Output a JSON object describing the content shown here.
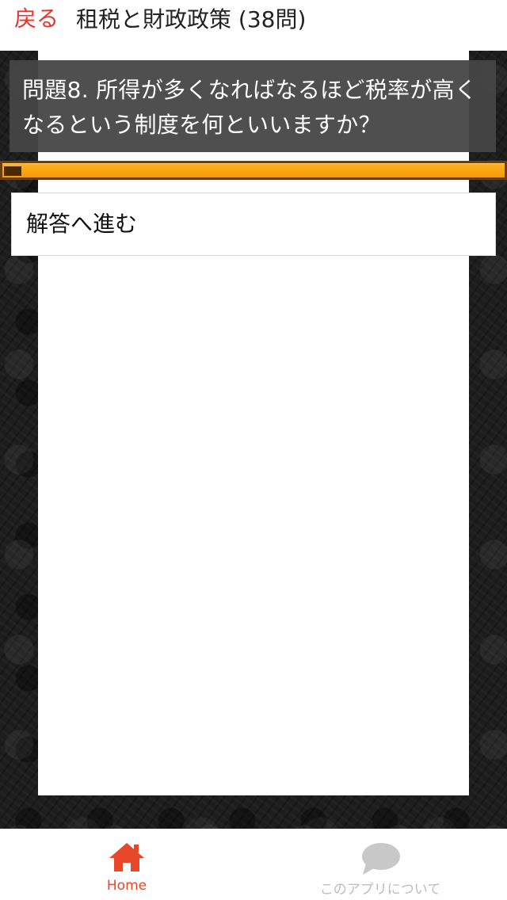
{
  "header": {
    "back_label": "戻る",
    "title": "租税と財政政策 (38問)"
  },
  "question": {
    "text": "問題8. 所得が多くなればなるほど税率が高くなるという制度を何といいますか？"
  },
  "progress": {
    "current": 8,
    "total": 38
  },
  "answer_button": {
    "label": "解答へ進む"
  },
  "tabbar": {
    "tabs": [
      {
        "label": "Home",
        "icon": "home-icon",
        "active": true
      },
      {
        "label": "このアプリについて",
        "icon": "speech-bubble-icon",
        "active": false
      }
    ]
  },
  "colors": {
    "accent": "#e8332a",
    "tab_active": "#e8472a",
    "tab_inactive": "#bdbdbd",
    "progress_fill": "#f5a416",
    "progress_border": "#6b3f06"
  }
}
